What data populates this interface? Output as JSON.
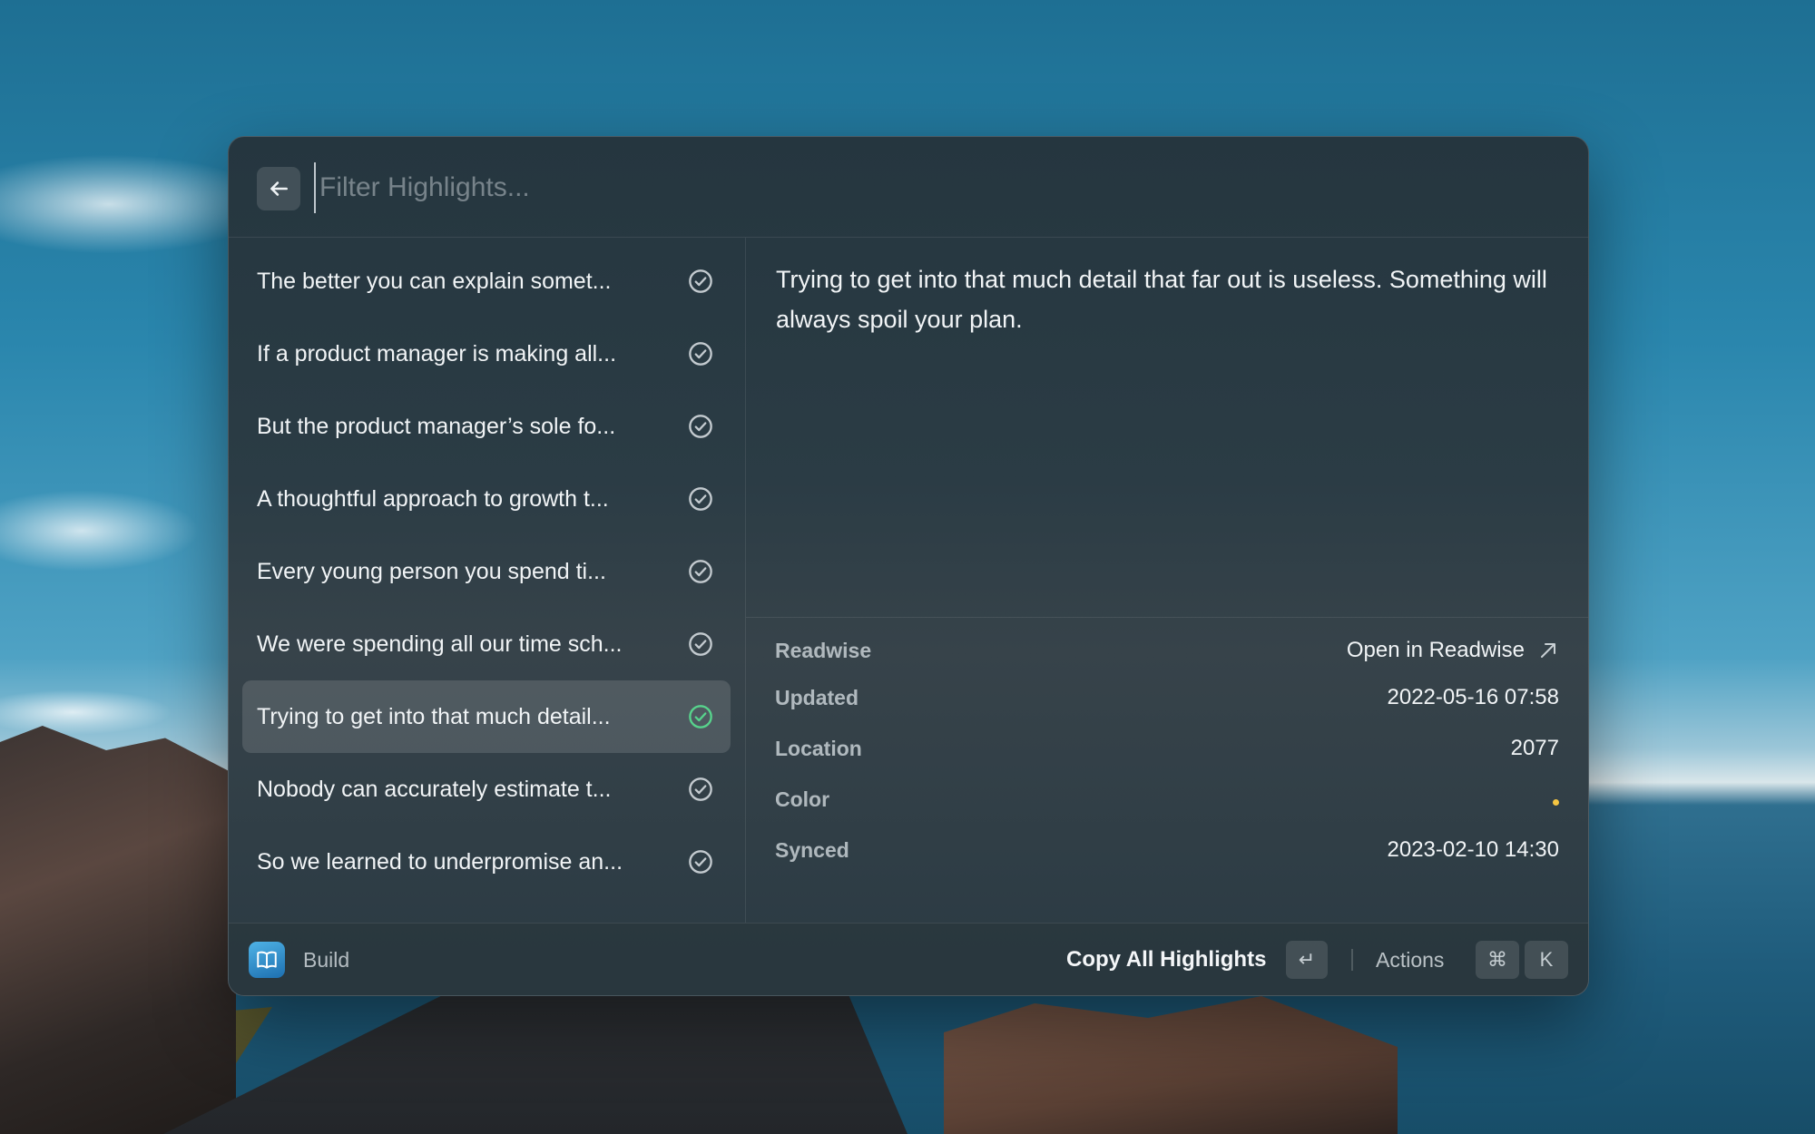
{
  "search": {
    "placeholder": "Filter Highlights..."
  },
  "highlights": [
    {
      "label": "The better you can explain somet...",
      "selected": false
    },
    {
      "label": "If a product manager is making all...",
      "selected": false
    },
    {
      "label": "But the product manager’s sole fo...",
      "selected": false
    },
    {
      "label": "A thoughtful approach to growth t...",
      "selected": false
    },
    {
      "label": "Every young person you spend ti...",
      "selected": false
    },
    {
      "label": "We were spending all our time sch...",
      "selected": false
    },
    {
      "label": "Trying to get into that much detail...",
      "selected": true
    },
    {
      "label": "Nobody can accurately estimate t...",
      "selected": false
    },
    {
      "label": "So we learned to underpromise an...",
      "selected": false
    }
  ],
  "detail": {
    "text": "Trying to get into that much detail that far out is useless. Something will always spoil your plan.",
    "metadata": {
      "readwise_key": "Readwise",
      "readwise_link": "Open in Readwise",
      "updated_key": "Updated",
      "updated_val": "2022-05-16 07:58",
      "location_key": "Location",
      "location_val": "2077",
      "color_key": "Color",
      "color_val": "#f5c542",
      "synced_key": "Synced",
      "synced_val": "2023-02-10 14:30"
    }
  },
  "footer": {
    "app_name": "Build",
    "primary_action": "Copy All Highlights",
    "enter_key": "↵",
    "actions_label": "Actions",
    "cmd_key": "⌘",
    "k_key": "K"
  },
  "colors": {
    "selected_check": "#57d38c",
    "check": "#c3cacf"
  }
}
